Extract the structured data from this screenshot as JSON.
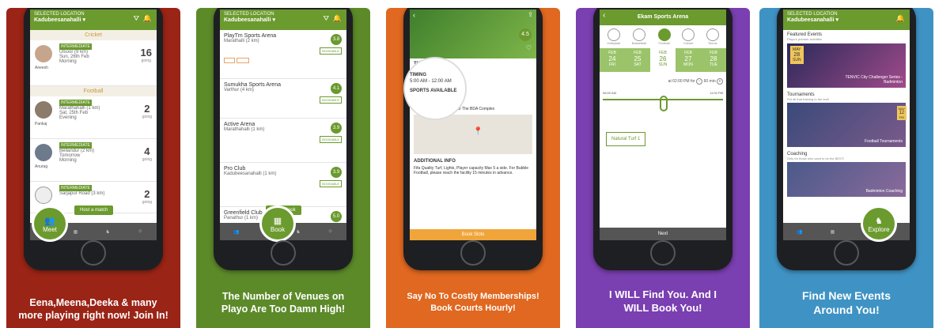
{
  "panels": [
    {
      "caption": "Eena,Meena,Deeka & many more playing right now! Join In!",
      "bg": "#9a2416"
    },
    {
      "caption": "The Number of Venues on Playo Are Too Damn High!",
      "bg": "#5c8a29"
    },
    {
      "caption": "Say No To Costly Memberships! Book Courts Hourly!",
      "bg": "#e06820"
    },
    {
      "caption": "I WILL Find You. And I WILL Book You!",
      "bg": "#7a3fb0"
    },
    {
      "caption": "Find New Events Around You!",
      "bg": "#3f93c4"
    }
  ],
  "meet": {
    "location_label": "SELECTED LOCATION",
    "location": "Kadubeesanahalli",
    "section_cricket": "Cricket",
    "section_football": "Football",
    "players": [
      {
        "name": "Aneesh",
        "level": "INTERMEDIATE",
        "place": "Ulsoor (9 km)",
        "date": "Sun, 26th Feb",
        "time": "Morning",
        "count": "16",
        "going": "going"
      },
      {
        "name": "Pankaj",
        "level": "INTERMEDIATE",
        "place": "Marathahalli (1 km)",
        "date": "Sat, 25th Feb",
        "time": "Evening",
        "count": "2",
        "going": "going"
      },
      {
        "name": "Anurag",
        "level": "INTERMEDIATE",
        "place": "Bellandur (2 km)",
        "date": "Tomorrow",
        "time": "Morning",
        "count": "4",
        "going": "going"
      },
      {
        "name": "",
        "level": "INTERMEDIATE",
        "place": "Sarjapur Road (3 km)",
        "date": "",
        "time": "",
        "count": "2",
        "going": "going"
      }
    ],
    "host_btn": "Host a match",
    "fab": "Meet"
  },
  "book": {
    "location_label": "SELECTED LOCATION",
    "location": "Kadubeesanahalli",
    "venues": [
      {
        "name": "PlayTm Sports Arena",
        "place": "Marathalli (2 km)",
        "rating": "3.8",
        "tag": "BOOKABLE"
      },
      {
        "name": "Sumukha Sports Arena",
        "place": "Varthur (4 km)",
        "rating": "4.1",
        "tag": "BOOKABLE"
      },
      {
        "name": "Active Arena",
        "place": "Marathahalli (1 km)",
        "rating": "3.9",
        "tag": "BOOKABLE"
      },
      {
        "name": "Pro Club",
        "place": "Kadubeesanahalli (1 km)",
        "rating": "3.9",
        "tag": "BOOKABLE"
      },
      {
        "name": "Greenfield Club",
        "place": "Panathur (1 km)",
        "rating": "5.0",
        "tag": ""
      }
    ],
    "quick_btn": "Quick Book",
    "fab": "Book"
  },
  "venue": {
    "rating": "4.5",
    "timing_label": "TIMING",
    "timing": "5:00 AM - 12:00 AM",
    "sports_label": "SPORTS AVAILABLE",
    "sport": "Football",
    "location_label": "LOCATION",
    "address": "36 Old Madras Road, Near The BDA Complex",
    "info_label": "ADDITIONAL INFO",
    "info": "Fifa Quality Turf, Lights, Player capacity Max 5 a side. For Bubble Football, please reach the facility 15 minutes in advance.",
    "book_btn": "Book Slots"
  },
  "slot": {
    "title": "Ekam Sports Arena",
    "sports": [
      "Volleyball",
      "Basketball",
      "Football",
      "Cricket",
      "Tennis"
    ],
    "days": [
      {
        "m": "FEB",
        "d": "24",
        "w": "FRI"
      },
      {
        "m": "FEB",
        "d": "25",
        "w": "SAT"
      },
      {
        "m": "FEB",
        "d": "26",
        "w": "SUN"
      },
      {
        "m": "FEB",
        "d": "27",
        "w": "MON"
      },
      {
        "m": "FEB",
        "d": "28",
        "w": "TUE"
      }
    ],
    "time_text": "at 02:00 PM for",
    "duration": "60 min",
    "start": "06:00 AM",
    "end": "11:00 PM",
    "court": "Natural Turf 1",
    "next": "Next"
  },
  "explore": {
    "location_label": "SELECTED LOCATION",
    "location": "Kadubeesanahalli",
    "featured_title": "Featured Events",
    "featured_sub": "Playo's premier activities",
    "event_month": "MAY",
    "event_day": "28",
    "event_wd": "SUN",
    "event_name": "TENVIC City Challenger Series - Badminton",
    "tour_title": "Tournaments",
    "tour_sub": "Put all that training to the test!",
    "tour_name": "Football Tournaments",
    "tour_month": "MAY",
    "tour_day": "12",
    "tour_wd": "FRI",
    "coach_title": "Coaching",
    "coach_sub": "Only for those who want to be the BEST!",
    "coach_name": "Badminton Coaching",
    "fab": "Explore"
  }
}
